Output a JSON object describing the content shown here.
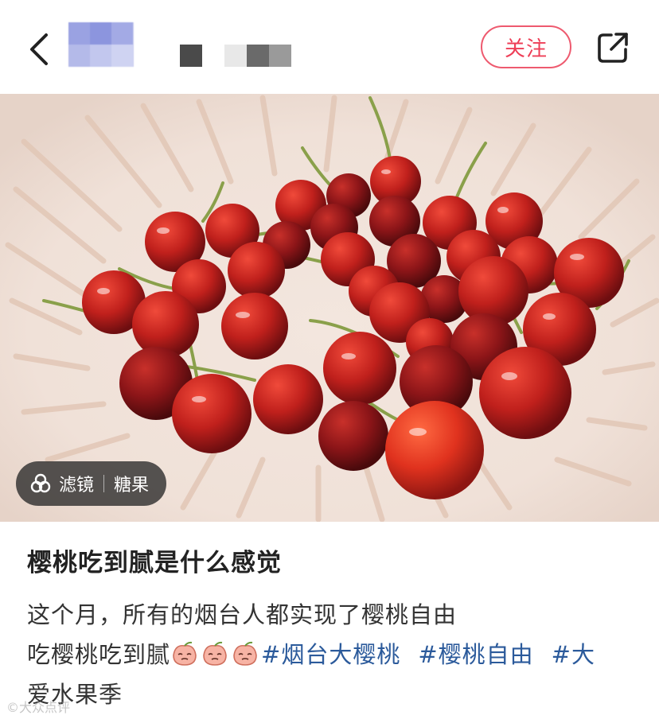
{
  "header": {
    "follow_label": "关注",
    "back_icon": "chevron-left-icon",
    "share_icon": "share-icon"
  },
  "image": {
    "subject": "cherries-in-colander",
    "filter_badge": {
      "icon": "filter-icon",
      "label": "滤镜",
      "value": "糖果"
    }
  },
  "post": {
    "title": "樱桃吃到腻是什么感觉",
    "line1": "这个月，所有的烟台人都实现了樱桃自由",
    "line2_text": "吃樱桃吃到腻",
    "emojis": [
      "peach-face-emoji",
      "peach-face-emoji",
      "peach-face-emoji"
    ],
    "tags": [
      "#烟台大樱桃",
      "#樱桃自由",
      "#大",
      "爱水果季"
    ]
  },
  "watermark": "©大众点评"
}
